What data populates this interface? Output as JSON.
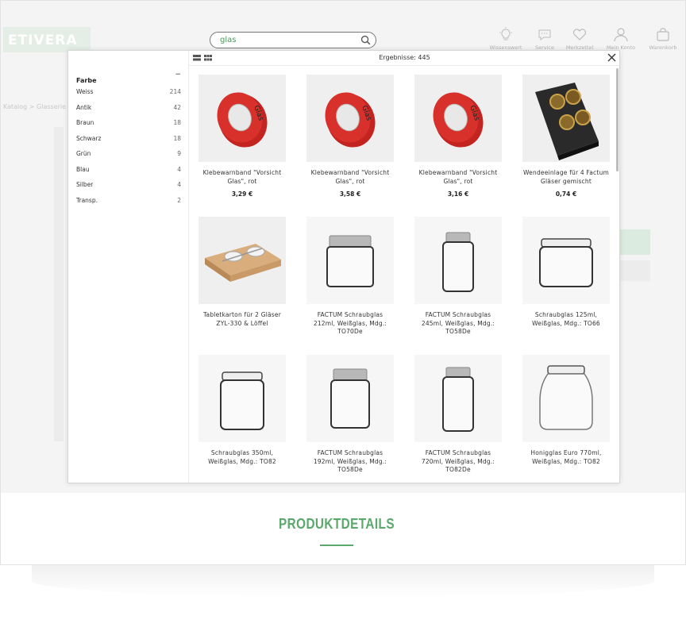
{
  "header": {
    "logo": "ETIVERA",
    "search_value": "glas",
    "icons": [
      {
        "label": "Wissenswert",
        "icon": "lightbulb-icon"
      },
      {
        "label": "Service",
        "icon": "chat-icon"
      },
      {
        "label": "Merkzettel",
        "icon": "heart-icon"
      },
      {
        "label": "Mein Konto",
        "icon": "user-icon"
      },
      {
        "label": "Warenkorb",
        "icon": "bag-icon"
      }
    ]
  },
  "breadcrumb": "Katalog  >  Glasserie",
  "overlay": {
    "results_label": "Ergebnisse: 445",
    "filter": {
      "title": "Farbe",
      "collapse_symbol": "−",
      "items": [
        {
          "label": "Weiss",
          "count": "214"
        },
        {
          "label": "Antik",
          "count": "42"
        },
        {
          "label": "Braun",
          "count": "18"
        },
        {
          "label": "Schwarz",
          "count": "18"
        },
        {
          "label": "Grün",
          "count": "9"
        },
        {
          "label": "Blau",
          "count": "4"
        },
        {
          "label": "Silber",
          "count": "4"
        },
        {
          "label": "Transp.",
          "count": "2"
        }
      ]
    },
    "products": [
      {
        "title": "Klebewarnband \"Vorsicht Glas\", rot",
        "price": "3,29 €",
        "image": "tape"
      },
      {
        "title": "Klebewarnband \"Vorsicht Glas\", rot",
        "price": "3,58 €",
        "image": "tape"
      },
      {
        "title": "Klebewarnband \"Vorsicht Glas\", rot",
        "price": "3,16 €",
        "image": "tape"
      },
      {
        "title": "Wendeeinlage für 4 Factum Gläser gemischt",
        "price": "0,74 €",
        "image": "tray"
      },
      {
        "title": "Tabletkarton für 2 Gläser ZYL-330 & Löffel",
        "price": "",
        "image": "box"
      },
      {
        "title": "FACTUM Schraubglas 212ml, Weißglas, Mdg.: TO70De",
        "price": "",
        "image": "jar-silver-wide"
      },
      {
        "title": "FACTUM Schraubglas 245ml, Weißglas, Mdg.: TO58De",
        "price": "",
        "image": "jar-silver-tall"
      },
      {
        "title": "Schraubglas 125ml, Weißglas, Mdg.: TO66",
        "price": "",
        "image": "jar-open-wide"
      },
      {
        "title": "Schraubglas 350ml, Weißglas, Mdg.: TO82",
        "price": "",
        "image": "jar-open"
      },
      {
        "title": "FACTUM Schraubglas 192ml, Weißglas, Mdg.: TO58De",
        "price": "",
        "image": "jar-silver"
      },
      {
        "title": "FACTUM Schraubglas 720ml, Weißglas, Mdg.: TO82De",
        "price": "",
        "image": "jar-silver-tall"
      },
      {
        "title": "Honigglas Euro 770ml, Weißglas, Mdg.: TO82",
        "price": "",
        "image": "jar-honey"
      }
    ]
  },
  "section": {
    "title": "PRODUKTDETAILS"
  },
  "colors": {
    "brand_green": "#5aa86c",
    "tape_red": "#d42a22"
  }
}
